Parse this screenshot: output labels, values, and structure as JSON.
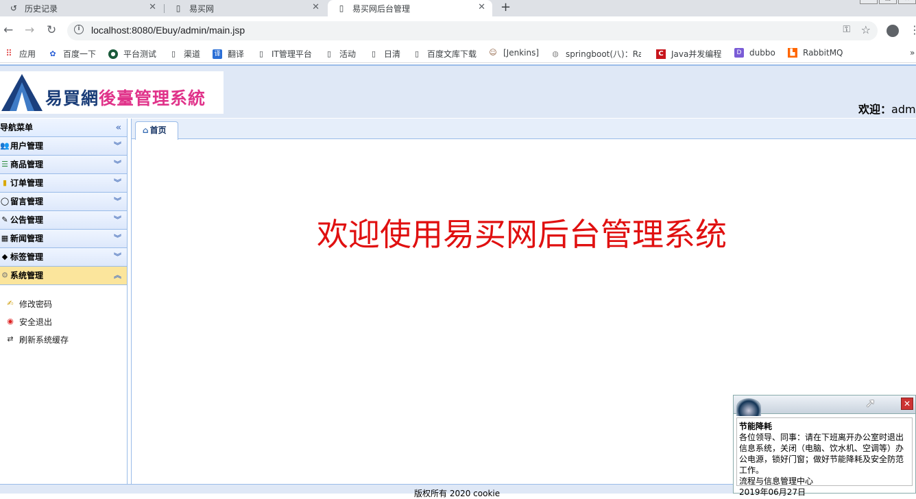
{
  "browser": {
    "tabs": [
      {
        "label": "历史记录",
        "icon": "history-icon"
      },
      {
        "label": "易买网",
        "icon": "page-icon"
      },
      {
        "label": "易买网后台管理",
        "icon": "page-icon",
        "active": true
      }
    ],
    "url": "localhost:8080/Ebuy/admin/main.jsp",
    "bookmarks": [
      {
        "label": "应用",
        "icon": "apps-icon"
      },
      {
        "label": "百度一下",
        "icon": "baidu-icon"
      },
      {
        "label": "平台测试",
        "icon": "site-icon"
      },
      {
        "label": "渠道",
        "icon": "page-icon"
      },
      {
        "label": "翻译",
        "icon": "translate-icon"
      },
      {
        "label": "IT管理平台",
        "icon": "page-icon"
      },
      {
        "label": "活动",
        "icon": "page-icon"
      },
      {
        "label": "日清",
        "icon": "page-icon"
      },
      {
        "label": "百度文库下载",
        "icon": "page-icon"
      },
      {
        "label": "[Jenkins]",
        "icon": "jenkins-icon"
      },
      {
        "label": "springboot(八)：Ra",
        "icon": "site-icon"
      },
      {
        "label": "Java并发编程",
        "icon": "csdn-icon"
      },
      {
        "label": "dubbo",
        "icon": "dubbo-icon"
      },
      {
        "label": "RabbitMQ",
        "icon": "rabbitmq-icon"
      }
    ],
    "more_bookmarks": "»"
  },
  "header": {
    "logo_part1": "易買網",
    "logo_part2": "後臺管理系統",
    "welcome_label": "欢迎：",
    "welcome_user": "admi"
  },
  "sidebar": {
    "title": "导航菜单",
    "menus": [
      {
        "label": "用户管理",
        "icon": "users-icon"
      },
      {
        "label": "商品管理",
        "icon": "list-icon"
      },
      {
        "label": "订单管理",
        "icon": "order-icon"
      },
      {
        "label": "留言管理",
        "icon": "message-icon"
      },
      {
        "label": "公告管理",
        "icon": "notice-icon"
      },
      {
        "label": "新闻管理",
        "icon": "news-icon"
      },
      {
        "label": "标签管理",
        "icon": "tag-icon"
      },
      {
        "label": "系统管理",
        "icon": "gear-icon",
        "open": true
      }
    ],
    "submenu": [
      {
        "label": "修改密码",
        "icon": "password-icon"
      },
      {
        "label": "安全退出",
        "icon": "logout-icon"
      },
      {
        "label": "刷新系统缓存",
        "icon": "refresh-icon"
      }
    ]
  },
  "main": {
    "tab_label": "首页",
    "welcome_text": "欢迎使用易买网后台管理系统"
  },
  "footer": {
    "text": "版权所有 2020 cookie"
  },
  "notice": {
    "title": "节能降耗",
    "body": "各位领导、同事：请在下班离开办公室时退出信息系统，关闭（电脑、饮水机、空调等）办公电源，锁好门窗；做好节能降耗及安全防范工作。",
    "signature": "流程与信息管理中心",
    "date": "2019年06月27日"
  }
}
